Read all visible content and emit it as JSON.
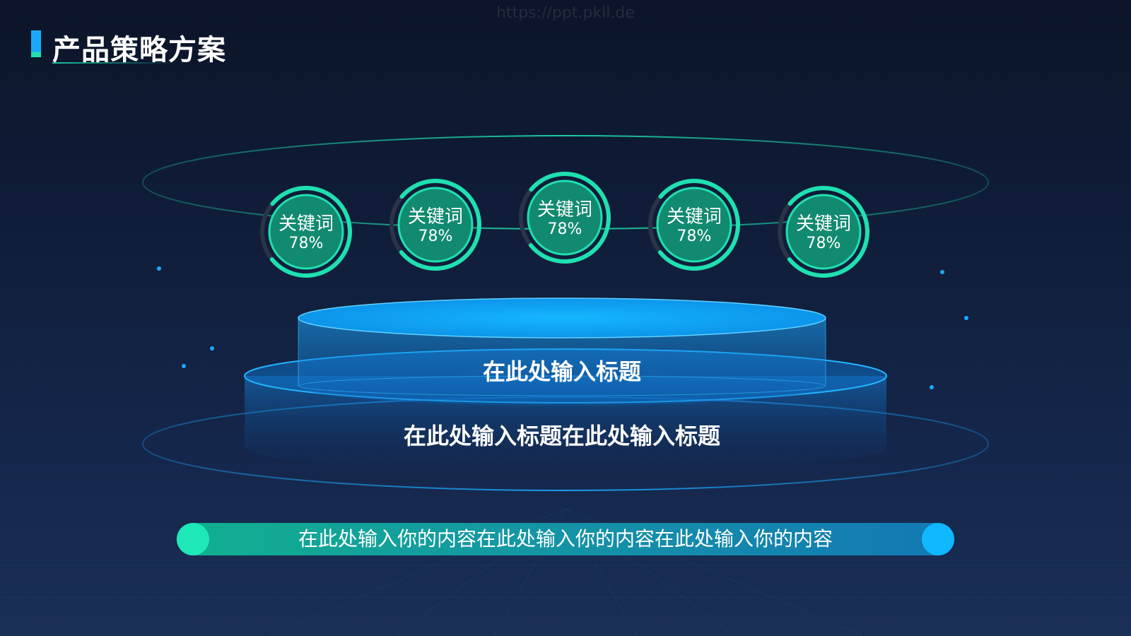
{
  "watermark": "https://ppt.pkll.de",
  "page_title": "产品策略方案",
  "keywords": [
    {
      "label": "关键词",
      "percent": "78%",
      "value": 0.78
    },
    {
      "label": "关键词",
      "percent": "78%",
      "value": 0.78
    },
    {
      "label": "关键词",
      "percent": "78%",
      "value": 0.78
    },
    {
      "label": "关键词",
      "percent": "78%",
      "value": 0.78
    },
    {
      "label": "关键词",
      "percent": "78%",
      "value": 0.78
    }
  ],
  "platform": {
    "top_title": "在此处输入标题",
    "bottom_title": "在此处输入标题在此处输入标题"
  },
  "content_bar": {
    "text": "在此处输入你的内容在此处输入你的内容在此处输入你的内容"
  },
  "colors": {
    "accent_green": "#1fe0b0",
    "accent_blue": "#1aa9ff",
    "background": "#0f1c36"
  }
}
